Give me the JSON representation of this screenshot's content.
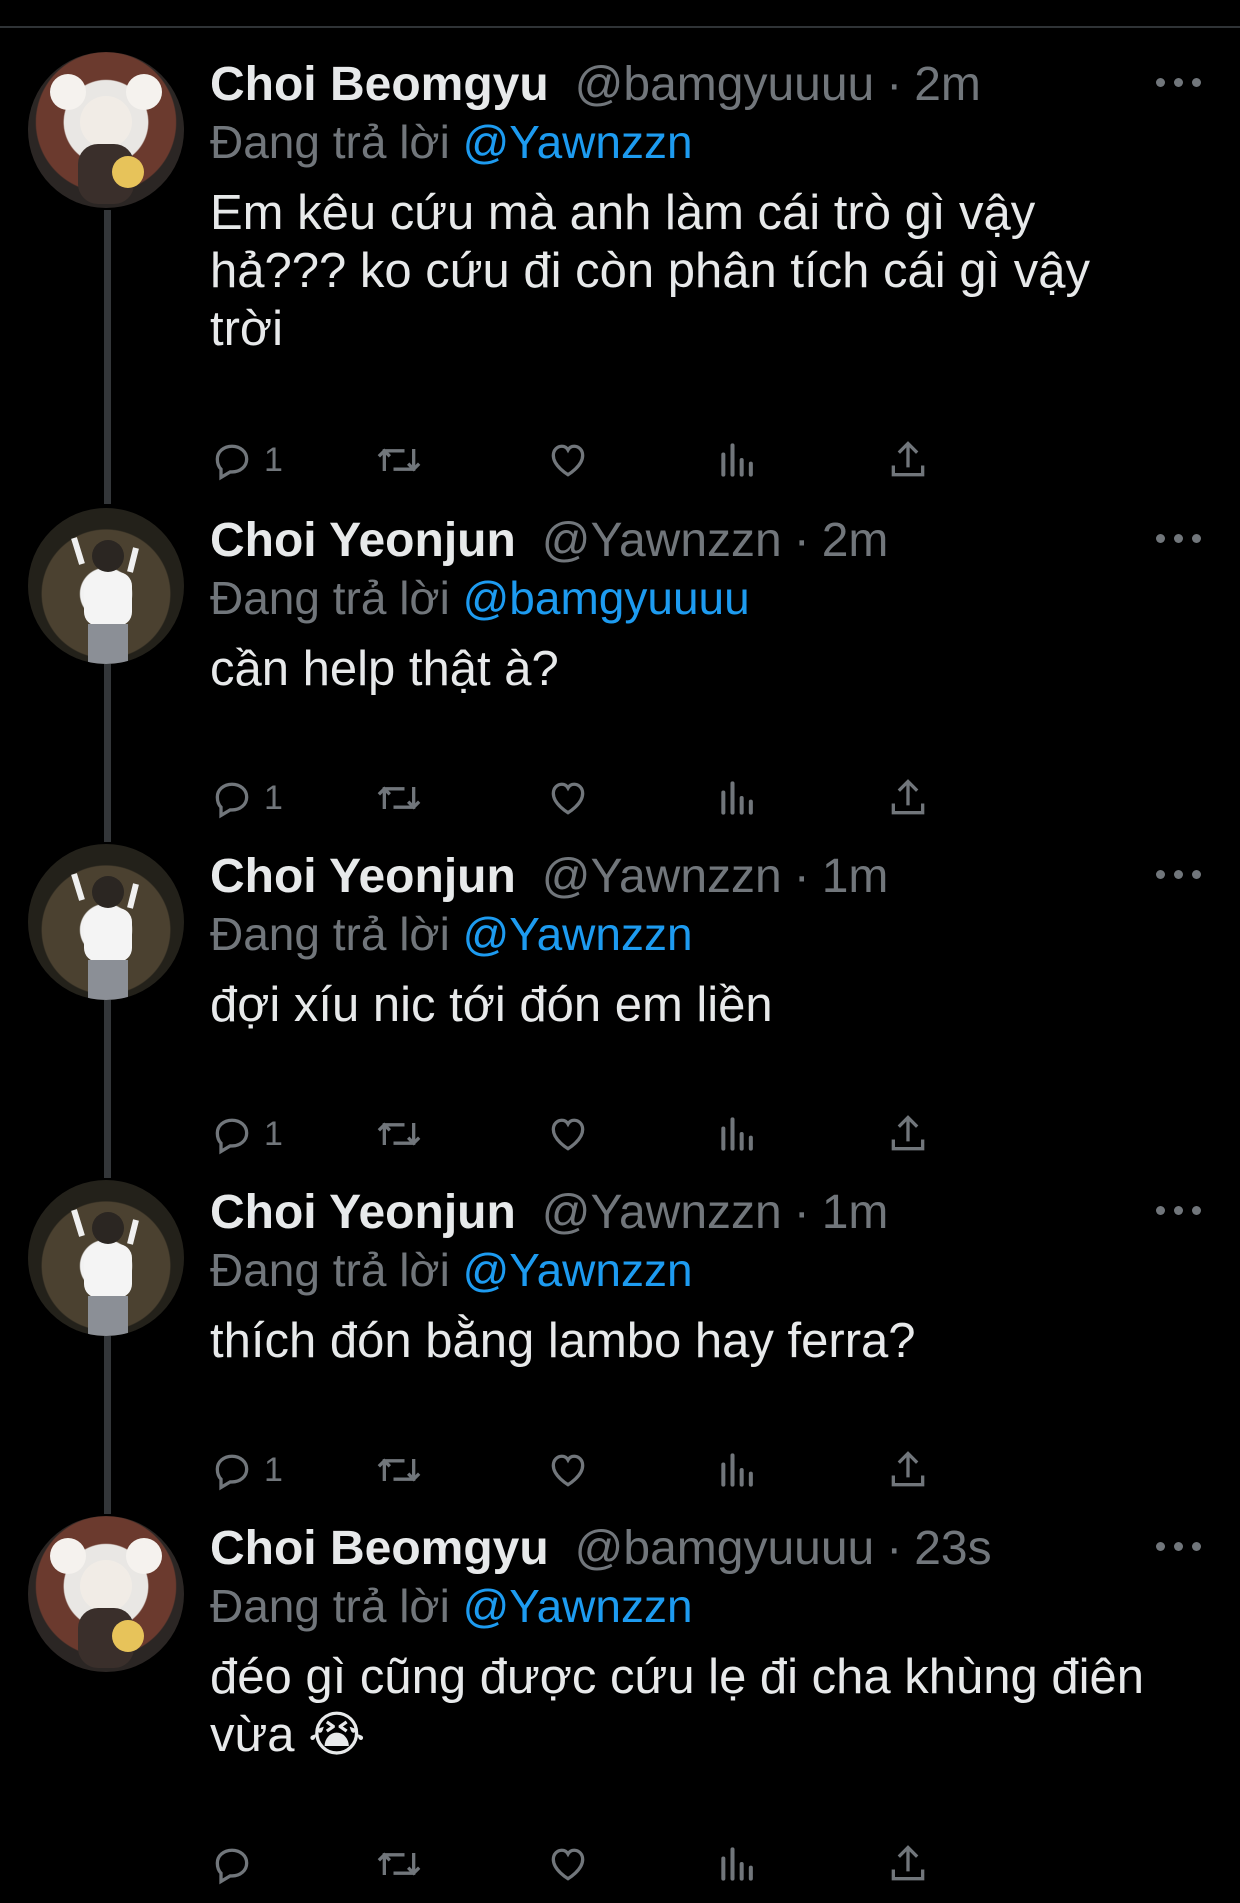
{
  "tweets": [
    {
      "name": "Choi Beomgyu",
      "handle": "@bamgyuuuu",
      "dot": "·",
      "time": "2m",
      "reply_prefix": "Đang trả lời",
      "reply_to": "@Yawnzzn",
      "text": "Em kêu cứu mà anh làm cái trò gì vậy hả??? ko cứu đi còn phân tích cái gì vậy trời",
      "reply_count": "1",
      "avatar": "beomgyu-avatar"
    },
    {
      "name": "Choi Yeonjun",
      "handle": "@Yawnzzn",
      "dot": "·",
      "time": "2m",
      "reply_prefix": "Đang trả lời",
      "reply_to": "@bamgyuuuu",
      "text": "cần help thật à?",
      "reply_count": "1",
      "avatar": "yeonjun-avatar"
    },
    {
      "name": "Choi Yeonjun",
      "handle": "@Yawnzzn",
      "dot": "·",
      "time": "1m",
      "reply_prefix": "Đang trả lời",
      "reply_to": "@Yawnzzn",
      "text": "đợi xíu nic tới đón em liền",
      "reply_count": "1",
      "avatar": "yeonjun-avatar"
    },
    {
      "name": "Choi Yeonjun",
      "handle": "@Yawnzzn",
      "dot": "·",
      "time": "1m",
      "reply_prefix": "Đang trả lời",
      "reply_to": "@Yawnzzn",
      "text": "thích đón bằng lambo hay ferra?",
      "reply_count": "1",
      "avatar": "yeonjun-avatar"
    },
    {
      "name": "Choi Beomgyu",
      "handle": "@bamgyuuuu",
      "dot": "·",
      "time": "23s",
      "reply_prefix": "Đang trả lời",
      "reply_to": "@Yawnzzn",
      "text": "đéo gì cũng được cứu lẹ đi cha khùng điên vừa 😭",
      "reply_count": "",
      "avatar": "beomgyu-avatar"
    }
  ],
  "icons": {
    "reply": "reply-icon",
    "retweet": "retweet-icon",
    "like": "heart-icon",
    "views": "views-icon",
    "share": "share-icon",
    "more": "more-icon"
  },
  "colors": {
    "background": "#000000",
    "text": "#e7e9ea",
    "muted": "#71767b",
    "link": "#1d9bf0"
  }
}
